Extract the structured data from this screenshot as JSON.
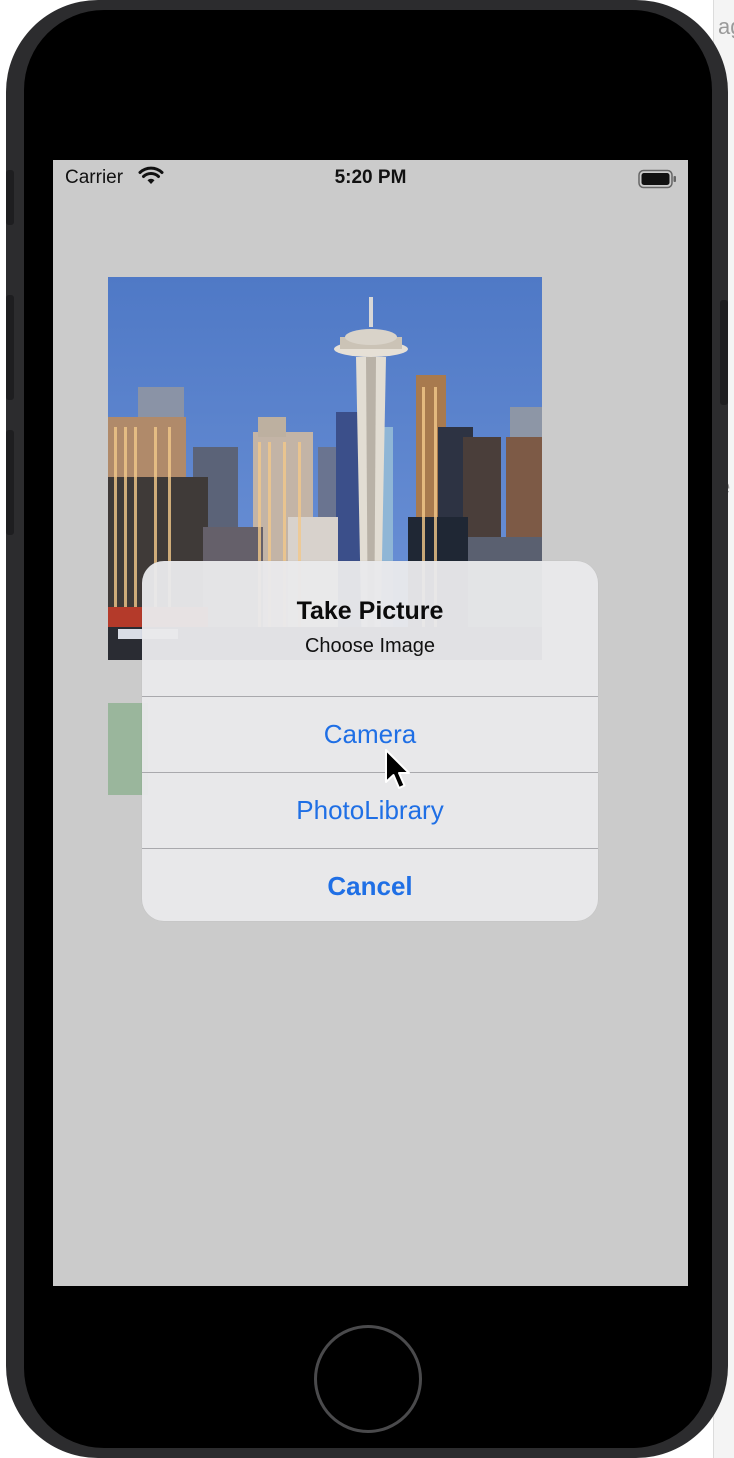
{
  "status_bar": {
    "carrier": "Carrier",
    "time": "5:20 PM",
    "wifi_icon": "wifi-icon",
    "battery_icon": "battery-icon"
  },
  "background_window": {
    "fragments": [
      "ag",
      "e"
    ]
  },
  "alert": {
    "title": "Take Picture",
    "message": "Choose Image",
    "actions": [
      {
        "label": "Camera",
        "style": "default"
      },
      {
        "label": "PhotoLibrary",
        "style": "default"
      },
      {
        "label": "Cancel",
        "style": "cancel"
      }
    ]
  },
  "colors": {
    "action_blue": "#1f6fe5",
    "screen_background": "#cbcbcb",
    "green_box": "#9ab69c"
  }
}
